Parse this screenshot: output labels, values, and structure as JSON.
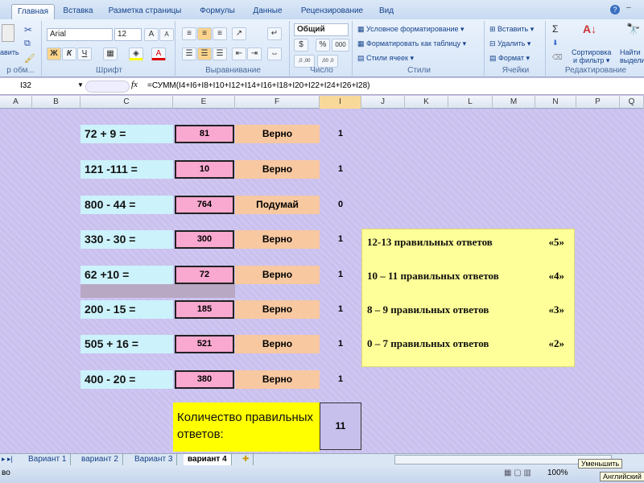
{
  "ribbon": {
    "tabs": [
      "Главная",
      "Вставка",
      "Разметка страницы",
      "Формулы",
      "Данные",
      "Рецензирование",
      "Вид"
    ],
    "clipboard": {
      "paste": "авить",
      "label": "р обм..."
    },
    "font": {
      "name": "Arial",
      "size": "12",
      "bold": "Ж",
      "italic": "К",
      "underline": "Ч",
      "grow": "A",
      "shrink": "A",
      "label": "Шрифт"
    },
    "alignment": {
      "label": "Выравнивание"
    },
    "number": {
      "format": "Общий",
      "percent": "%",
      "thousands": "000",
      "inc": ",0 ,00",
      "dec": ",00 ,0",
      "label": "Число"
    },
    "styles": {
      "conditional": "Условное форматирование",
      "table": "Форматировать как таблицу",
      "cell": "Стили ячеек",
      "label": "Стили"
    },
    "cells": {
      "insert": "Вставить",
      "delete": "Удалить",
      "format": "Формат",
      "label": "Ячейки"
    },
    "editing": {
      "sum": "Σ",
      "sort": "Сортировка",
      "sort2": "и фильтр",
      "find": "Найти",
      "find2": "выдели",
      "label": "Редактирование"
    }
  },
  "formula_bar": {
    "name_box": "I32",
    "fx": "fx",
    "formula": "=СУММ(I4+I6+I8+I10+I12+I14+I16+I18+I20+I22+I24+I26+I28)"
  },
  "columns": [
    "A",
    "B",
    "C",
    "E",
    "F",
    "I",
    "J",
    "K",
    "L",
    "M",
    "N",
    "P",
    "Q"
  ],
  "tasks": [
    {
      "expr": "72 + 9 =",
      "answer": "81",
      "result": "Верно",
      "points": "1"
    },
    {
      "expr": "121 -111 =",
      "answer": "10",
      "result": "Верно",
      "points": "1"
    },
    {
      "expr": "800 - 44 =",
      "answer": "764",
      "result": "Подумай",
      "points": "0"
    },
    {
      "expr": "330 - 30 =",
      "answer": "300",
      "result": "Верно",
      "points": "1"
    },
    {
      "expr": "62 +10 =",
      "answer": "72",
      "result": "Верно",
      "points": "1"
    },
    {
      "expr": "200 - 15 =",
      "answer": "185",
      "result": "Верно",
      "points": "1"
    },
    {
      "expr": "505 + 16 =",
      "answer": "521",
      "result": "Верно",
      "points": "1"
    },
    {
      "expr": "400 - 20 =",
      "answer": "380",
      "result": "Верно",
      "points": "1"
    }
  ],
  "grading": [
    {
      "range": "12-13 правильных ответов",
      "mark": "«5»"
    },
    {
      "range": "10 – 11 правильных ответов",
      "mark": "«4»"
    },
    {
      "range": "8 – 9 правильных ответов",
      "mark": "«3»"
    },
    {
      "range": "0 – 7 правильных ответов",
      "mark": "«2»"
    }
  ],
  "summary": {
    "label": "Количество правильных ответов:",
    "value": "11"
  },
  "sheet_tabs": [
    "Вариант 1",
    "вариант 2",
    "Вариант 3",
    "вариант 4"
  ],
  "status": {
    "left": "во",
    "zoom": "100%",
    "tooltip": "Уменьшить",
    "lang": "Английский"
  }
}
